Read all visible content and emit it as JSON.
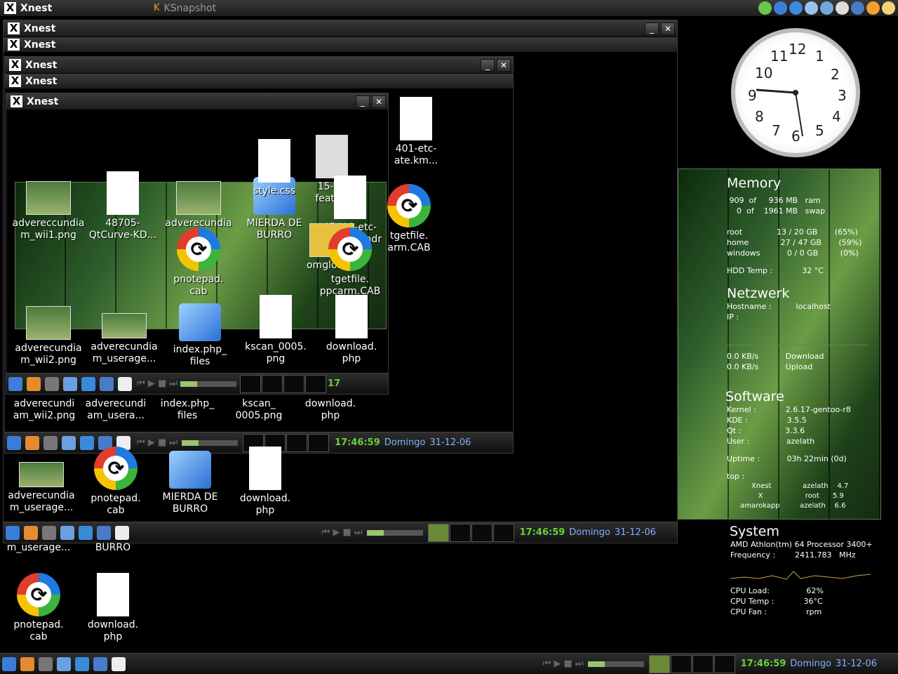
{
  "top_bar": {
    "left_app": "Xnest",
    "right_app": "KSnapshot"
  },
  "windows": {
    "w1_title": "Xnest",
    "w1_sub": "Xnest",
    "w2_title": "Xnest",
    "w2_sub": "Xnest",
    "w3_title": "Xnest"
  },
  "icons_w3": [
    {
      "label": "advereccundia\nm_wii1.png"
    },
    {
      "label": "48705-\nQtCurve-KD..."
    },
    {
      "label": "adverecundia\n"
    },
    {
      "label": "MIERDA DE\nBURRO"
    },
    {
      "label": "pnotepad.\ncab"
    },
    {
      "label": "style.css"
    },
    {
      "label": "15-bo\nfeat_lu"
    },
    {
      "label": "45401-etc-\nupdate.kmdr"
    },
    {
      "label": "omglol.zip"
    },
    {
      "label": "tgetfile.\nppcarm.CAB"
    },
    {
      "label": "adverecundia\nm_wii2.png"
    },
    {
      "label": "adverecundia\nm_userage..."
    },
    {
      "label": "index.php_\nfiles"
    },
    {
      "label": "kscan_0005.\npng"
    },
    {
      "label": "download.\nphp"
    }
  ],
  "icons_w2": [
    {
      "label": "adverecundi\nam_wii2.png"
    },
    {
      "label": "adverecundi\nam_usera..."
    },
    {
      "label": "index.php_\nfiles"
    },
    {
      "label": "kscan_\n0005.png"
    },
    {
      "label": "download.\nphp"
    },
    {
      "label": "401-etc-\nate.km..."
    },
    {
      "label": "tgetfile.\narm.CAB"
    }
  ],
  "icons_w1": [
    {
      "label": "adverecundia\nm_userage..."
    },
    {
      "label": "pnotepad.\ncab"
    },
    {
      "label": "MIERDA DE\nBURRO"
    },
    {
      "label": "download.\nphp"
    }
  ],
  "icons_desk": [
    {
      "label": "m_userage..."
    },
    {
      "label": "BURRO"
    },
    {
      "label": "pnotepad.\ncab"
    },
    {
      "label": "download.\nphp"
    }
  ],
  "panel": {
    "clock": "17:46:59",
    "day": "Domingo",
    "date": "31-12-06",
    "w3_clock_partial": "17"
  },
  "sysmon": {
    "memory_title": "Memory",
    "mem_lines": [
      " 909  of     936 MB   ram",
      "    0  of    1961 MB   swap"
    ],
    "disk_lines": [
      "root              13 / 20 GB       (65%)",
      "home             27 / 47 GB       (59%)",
      "windows           0 / 0 GB         (0%)"
    ],
    "hdd": "HDD Temp :            32 °C",
    "net_title": "Netzwerk",
    "net_lines": [
      "Hostname :          localhost",
      "IP :"
    ],
    "traffic": [
      "0.0 KB/s           Download",
      "0.0 KB/s           Upload"
    ],
    "soft_title": "Software",
    "soft_lines": [
      "Kernel :            2.6.17-gentoo-r8",
      "KDE :                3.5.5",
      "Qt :                  3.3.6",
      "User :               azelath",
      "",
      "Uptime :           03h 22min (0d)",
      "",
      "top :"
    ],
    "top_lines": [
      "           Xnest              azelath    4.7",
      "              X                   root      5.9",
      "      amarokapp         azelath    6.6"
    ],
    "sys_title": "System",
    "sys_lines": [
      "AMD Athlon(tm) 64 Processor 3400+",
      "Frequency :        2411.783   MHz"
    ],
    "cpu_lines": [
      "CPU Load:               62%",
      "CPU Temp :            36°C",
      "CPU Fan :                rpm"
    ]
  },
  "clock_face": {
    "numbers": [
      "12",
      "1",
      "2",
      "3",
      "4",
      "5",
      "6",
      "7",
      "8",
      "9",
      "10",
      "11"
    ]
  }
}
